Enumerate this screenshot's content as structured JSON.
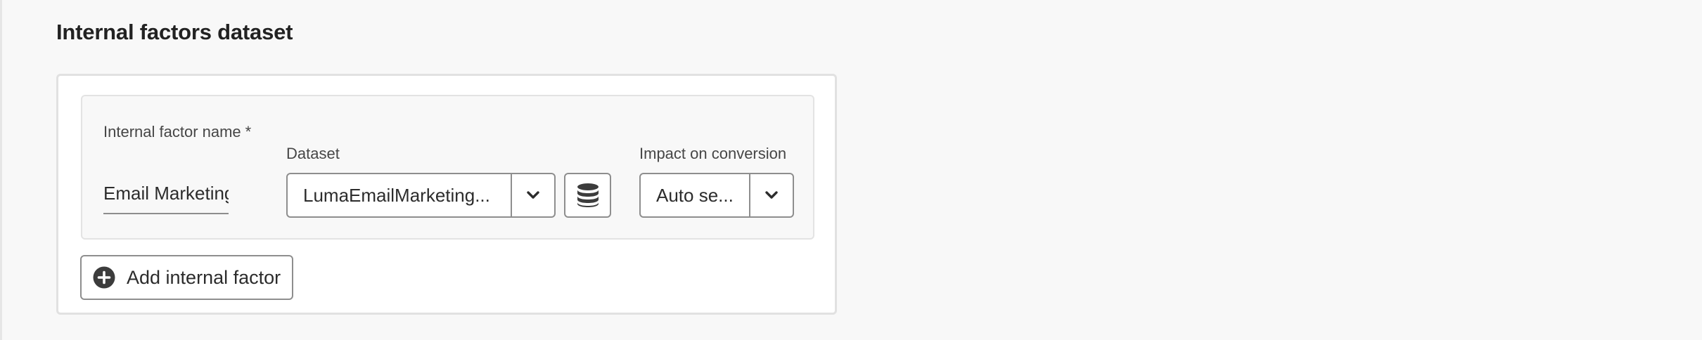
{
  "section": {
    "title": "Internal factors dataset"
  },
  "factor": {
    "name_label": "Internal factor name",
    "required_mark": "*",
    "name_value": "Email Marketing ...",
    "dataset_label": "Dataset",
    "dataset_value": "LumaEmailMarketing...",
    "impact_label": "Impact on conversion",
    "impact_value": "Auto se..."
  },
  "actions": {
    "add_label": "Add internal factor"
  },
  "icons": {
    "dataset_toggle": "chevron-down-icon",
    "dataset_browse": "database-icon",
    "impact_toggle": "chevron-down-icon",
    "add": "add-circle-icon"
  },
  "colors": {
    "background": "#f8f8f8",
    "panel": "#ffffff",
    "border": "#8e8e8e",
    "text": "#2c2c2c",
    "icon": "#3c3c3c"
  }
}
